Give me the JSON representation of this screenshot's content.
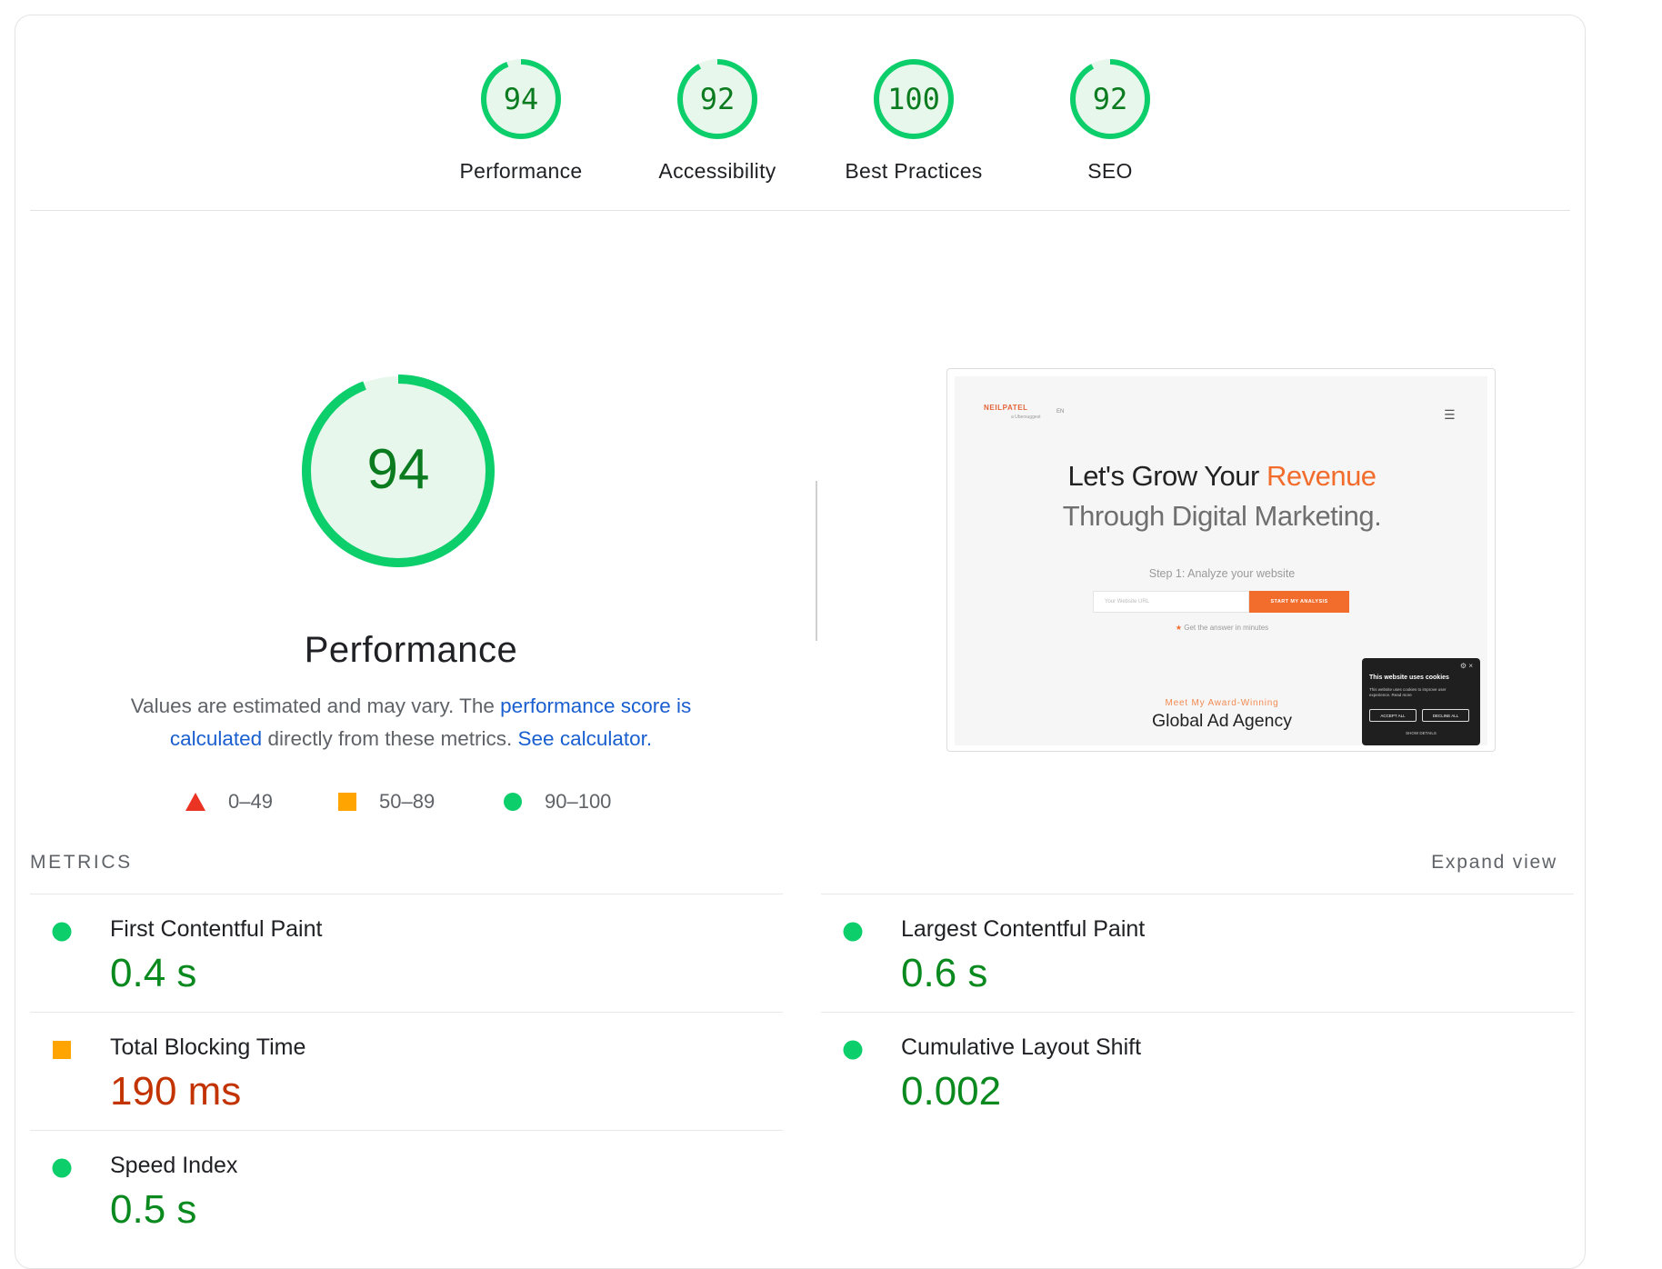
{
  "categories": [
    {
      "score": "94",
      "label": "Performance"
    },
    {
      "score": "92",
      "label": "Accessibility"
    },
    {
      "score": "100",
      "label": "Best Practices"
    },
    {
      "score": "92",
      "label": "SEO"
    }
  ],
  "performance": {
    "score": "94",
    "title": "Performance",
    "desc_prefix": "Values are estimated and may vary. The ",
    "desc_link1": "performance score is calculated",
    "desc_middle": " directly from these metrics. ",
    "desc_link2": "See calculator.",
    "legend": [
      {
        "range": "0–49",
        "shape": "triangle",
        "color": "#eb3323"
      },
      {
        "range": "50–89",
        "shape": "square",
        "color": "#ffa400"
      },
      {
        "range": "90–100",
        "shape": "circle",
        "color": "#0cce6b"
      }
    ]
  },
  "screenshot": {
    "logo": "NEILPATEL",
    "logo_sub": "a Ubersuggest",
    "lang": "EN",
    "heading_part1": "Let's Grow Your ",
    "heading_accent": "Revenue",
    "heading_line2": "Through Digital Marketing.",
    "step": "Step 1: Analyze your website",
    "input_placeholder": "Your Website URL",
    "button": "START MY ANALYSIS",
    "answer": "Get the answer in minutes",
    "meet": "Meet My Award-Winning",
    "agency": "Global Ad Agency",
    "cookie_title": "This website uses cookies",
    "cookie_body": "This website uses cookies to improve user experience. Read more",
    "accept": "ACCEPT ALL",
    "decline": "DECLINE ALL",
    "show_details": "SHOW DETAILS"
  },
  "metrics": {
    "label": "METRICS",
    "expand": "Expand view",
    "items": [
      {
        "name": "First Contentful Paint",
        "value": "0.4 s",
        "status": "good"
      },
      {
        "name": "Largest Contentful Paint",
        "value": "0.6 s",
        "status": "good"
      },
      {
        "name": "Total Blocking Time",
        "value": "190 ms",
        "status": "average"
      },
      {
        "name": "Cumulative Layout Shift",
        "value": "0.002",
        "status": "good"
      },
      {
        "name": "Speed Index",
        "value": "0.5 s",
        "status": "good"
      }
    ]
  },
  "colors": {
    "good": "#0cce6b",
    "good_text": "#0a8a1e",
    "average": "#ffa400",
    "average_text": "#c33300",
    "link": "#1a5fd0"
  }
}
